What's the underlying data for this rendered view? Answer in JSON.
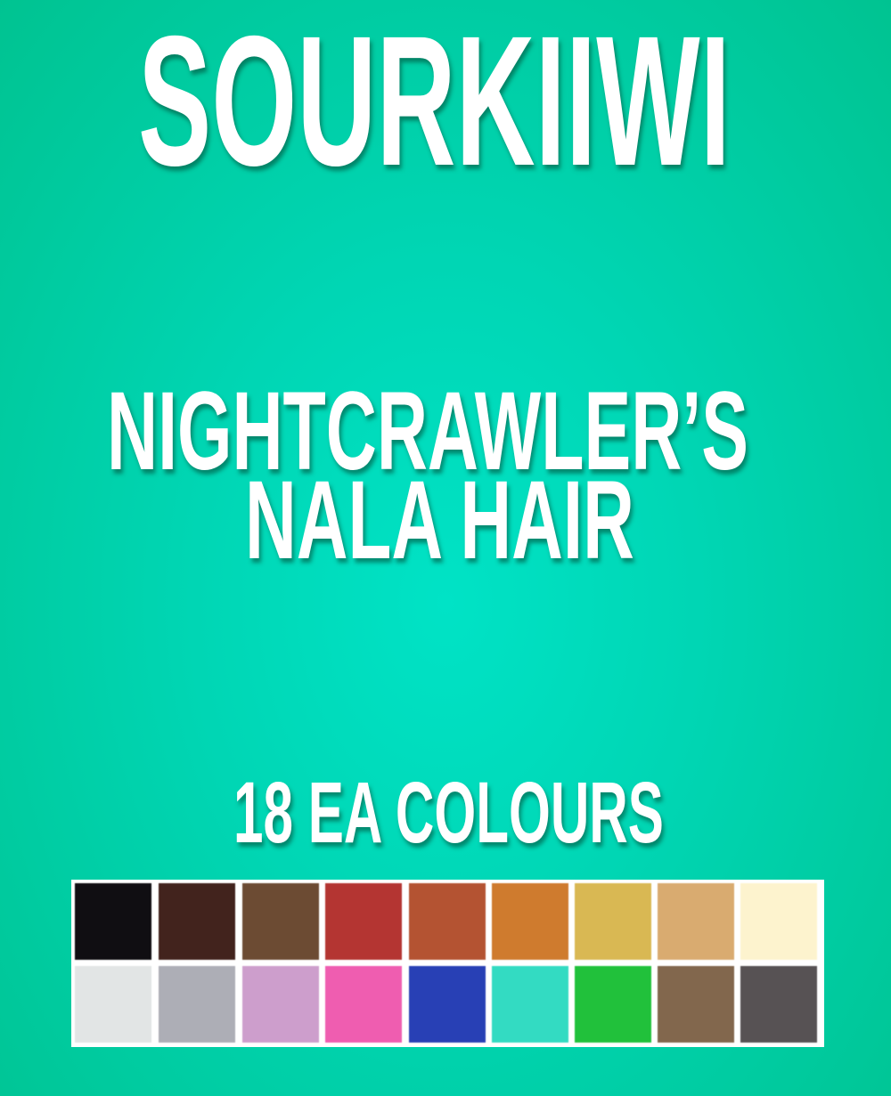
{
  "brand": "SOURKIIWI",
  "title_line1": "NIGHTCRAWLER’S",
  "title_line2": "NALA HAIR",
  "subtitle": "18 EA COLOURS",
  "background_color": "#00d8b8",
  "swatches": [
    [
      "#100e12",
      "#42231d",
      "#6c4b33",
      "#b43532",
      "#b45332",
      "#cf7b2e",
      "#d9b853",
      "#d9ab70",
      "#fdf3ce"
    ],
    [
      "#e2e5e5",
      "#adaeb6",
      "#cd9ecc",
      "#ef5db0",
      "#2840b5",
      "#33dbc2",
      "#21c13b",
      "#82674d",
      "#575254"
    ]
  ]
}
